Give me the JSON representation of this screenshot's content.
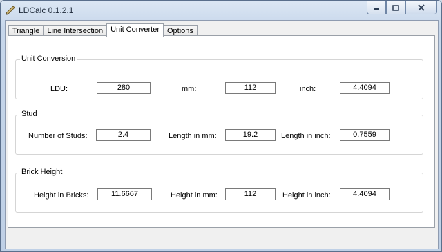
{
  "window": {
    "title": "LDCalc 0.1.2.1"
  },
  "tabs": [
    {
      "label": "Triangle"
    },
    {
      "label": "Line Intersection"
    },
    {
      "label": "Unit Converter"
    },
    {
      "label": "Options"
    }
  ],
  "unit_conversion": {
    "title": "Unit Conversion",
    "ldu_label": "LDU:",
    "ldu_value": "280",
    "mm_label": "mm:",
    "mm_value": "112",
    "inch_label": "inch:",
    "inch_value": "4.4094"
  },
  "stud": {
    "title": "Stud",
    "studs_label": "Number of Studs:",
    "studs_value": "2.4",
    "mm_label": "Length in mm:",
    "mm_value": "19.2",
    "inch_label": "Length in inch:",
    "inch_value": "0.7559"
  },
  "brick_height": {
    "title": "Brick Height",
    "bricks_label": "Height in Bricks:",
    "bricks_value": "11.6667",
    "mm_label": "Height in mm:",
    "mm_value": "112",
    "inch_label": "Height in inch:",
    "inch_value": "4.4094"
  },
  "icons": {
    "app": "calculator-pencil-icon",
    "minimize": "minimize-icon",
    "maximize": "maximize-icon",
    "close": "close-icon"
  }
}
